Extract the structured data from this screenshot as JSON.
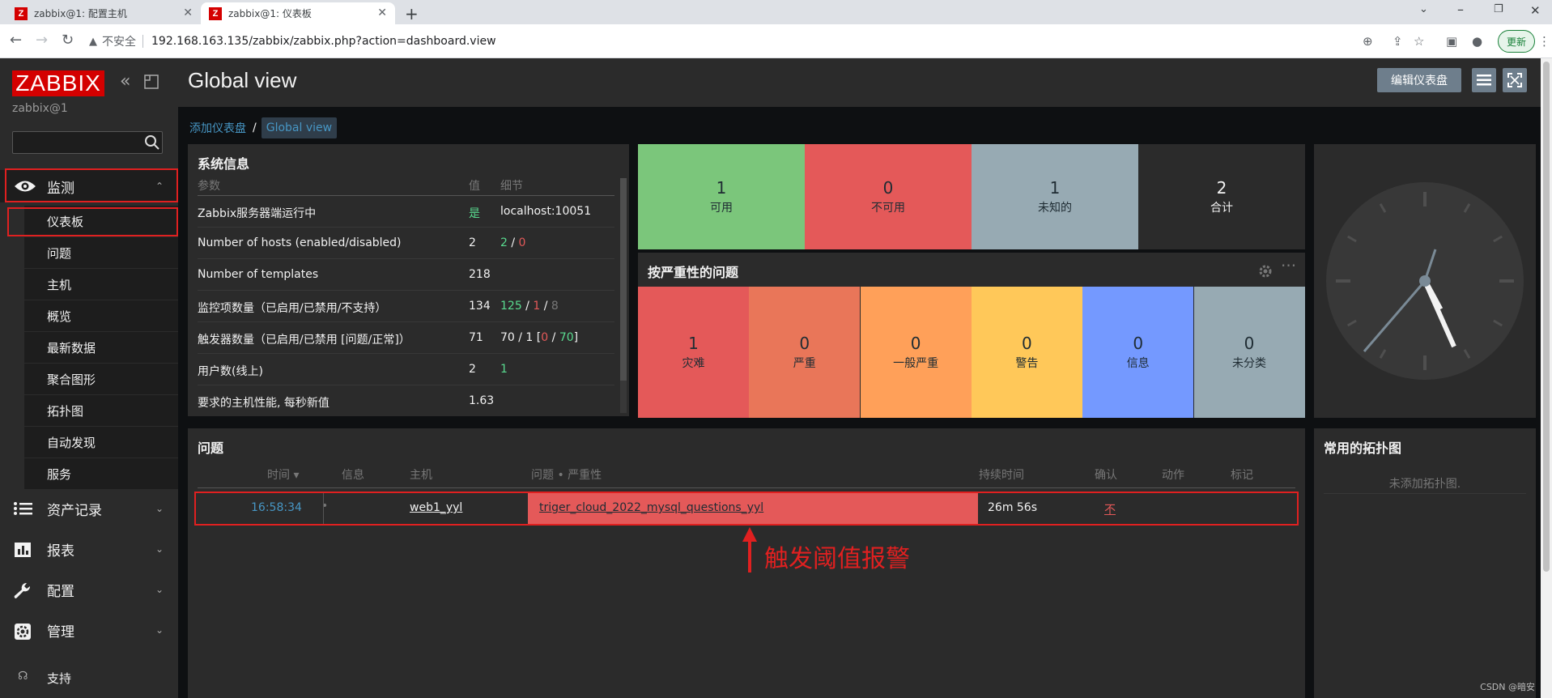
{
  "browser": {
    "tabs": [
      {
        "title": "zabbix@1: 配置主机"
      },
      {
        "title": "zabbix@1: 仪表板"
      }
    ],
    "security_label": "不安全",
    "url": "192.168.163.135/zabbix/zabbix.php?action=dashboard.view",
    "update_label": "更新"
  },
  "sidebar": {
    "brand": "ZABBIX",
    "user": "zabbix@1",
    "search_placeholder": "",
    "sections": [
      {
        "label": "监测",
        "icon": "eye-icon"
      },
      {
        "label": "资产记录",
        "icon": "list-icon"
      },
      {
        "label": "报表",
        "icon": "bar-chart-icon"
      },
      {
        "label": "配置",
        "icon": "wrench-icon"
      },
      {
        "label": "管理",
        "icon": "gear-icon"
      }
    ],
    "monitoring_items": [
      "仪表板",
      "问题",
      "主机",
      "概览",
      "最新数据",
      "聚合图形",
      "拓扑图",
      "自动发现",
      "服务"
    ],
    "support_label": "支持"
  },
  "header": {
    "title": "Global view",
    "edit_button": "编辑仪表盘"
  },
  "breadcrumb": {
    "parent": "添加仪表盘",
    "separator": "/",
    "current": "Global view"
  },
  "system_info": {
    "title": "系统信息",
    "columns": [
      "参数",
      "值",
      "细节"
    ],
    "rows": [
      {
        "param": "Zabbix服务器端运行中",
        "value": "是",
        "detail": "localhost:10051"
      },
      {
        "param": "Number of hosts (enabled/disabled)",
        "value": "2",
        "d1": "2",
        "s1": " / ",
        "d2": "0"
      },
      {
        "param": "Number of templates",
        "value": "218"
      },
      {
        "param": "监控项数量（已启用/已禁用/不支持）",
        "value": "134",
        "d1": "125",
        "s1": " / ",
        "d2": "1",
        "s2": " / ",
        "d3": "8"
      },
      {
        "param": "触发器数量（已启用/已禁用 [问题/正常]）",
        "value": "71",
        "d0": "70 / 1 [",
        "d1": "0",
        "s1": " / ",
        "d2": "70",
        "s2": "]"
      },
      {
        "param": "用户数(线上)",
        "value": "2",
        "d1": "1"
      },
      {
        "param": "要求的主机性能, 每秒新值",
        "value": "1.63"
      }
    ]
  },
  "host_availability": [
    {
      "count": "1",
      "label": "可用",
      "color": "#7bc67b"
    },
    {
      "count": "0",
      "label": "不可用",
      "color": "#e45959"
    },
    {
      "count": "1",
      "label": "未知的",
      "color": "#97aab3"
    },
    {
      "count": "2",
      "label": "合计",
      "color": "#2b2b2b"
    }
  ],
  "severity": {
    "title": "按严重性的问题",
    "items": [
      {
        "count": "1",
        "label": "灾难",
        "color": "#e45959"
      },
      {
        "count": "0",
        "label": "严重",
        "color": "#e97659"
      },
      {
        "count": "0",
        "label": "一般严重",
        "color": "#ffa059"
      },
      {
        "count": "0",
        "label": "警告",
        "color": "#ffc859"
      },
      {
        "count": "0",
        "label": "信息",
        "color": "#7499ff"
      },
      {
        "count": "0",
        "label": "未分类",
        "color": "#97aab3"
      }
    ]
  },
  "problems": {
    "title": "问题",
    "columns": [
      "时间 ▾",
      "信息",
      "主机",
      "问题 • 严重性",
      "持续时间",
      "确认",
      "动作",
      "标记"
    ],
    "rows": [
      {
        "time": "16:58:34",
        "host": "web1_yyl",
        "problem": "triger_cloud_2022_mysql_questions_yyl",
        "duration": "26m 56s",
        "ack": "不"
      }
    ]
  },
  "maps": {
    "title": "常用的拓扑图",
    "empty": "未添加拓扑图."
  },
  "annotation": {
    "text": "触发阈值报警",
    "color": "#e02020"
  },
  "watermark": "CSDN @暗安"
}
